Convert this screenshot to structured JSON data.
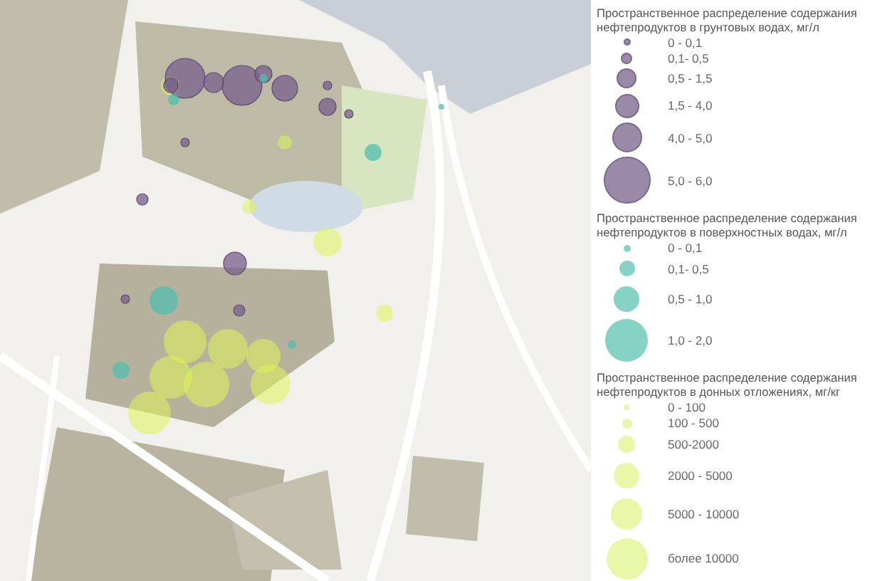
{
  "legend": {
    "sections": [
      {
        "title": "Пространственное распределение содержания нефтепродуктов в грунтовых водах, мг/л",
        "color": "#9a8aa8",
        "items": [
          {
            "label": "0 - 0,1"
          },
          {
            "label": "0,1- 0,5"
          },
          {
            "label": "0,5 - 1,5"
          },
          {
            "label": "1,5 - 4,0"
          },
          {
            "label": "4,0 - 5,0"
          },
          {
            "label": "5,0 - 6,0"
          }
        ]
      },
      {
        "title": "Пространственное распределение содержания нефтепродуктов в поверхностных водах, мг/л",
        "color": "#86d3c6",
        "items": [
          {
            "label": "0 - 0,1"
          },
          {
            "label": "0,1- 0,5"
          },
          {
            "label": "0,5 - 1,0"
          },
          {
            "label": "1,0 - 2,0"
          }
        ]
      },
      {
        "title": "Пространственное распределение содержания нефтепродуктов в донных отложениях, мг/кг",
        "color": "#e9f8a8",
        "items": [
          {
            "label": "0 - 100"
          },
          {
            "label": "100 - 500"
          },
          {
            "label": "500-2000"
          },
          {
            "label": "2000 - 5000"
          },
          {
            "label": "5000 - 10000"
          },
          {
            "label": "более 10000"
          }
        ]
      }
    ]
  }
}
